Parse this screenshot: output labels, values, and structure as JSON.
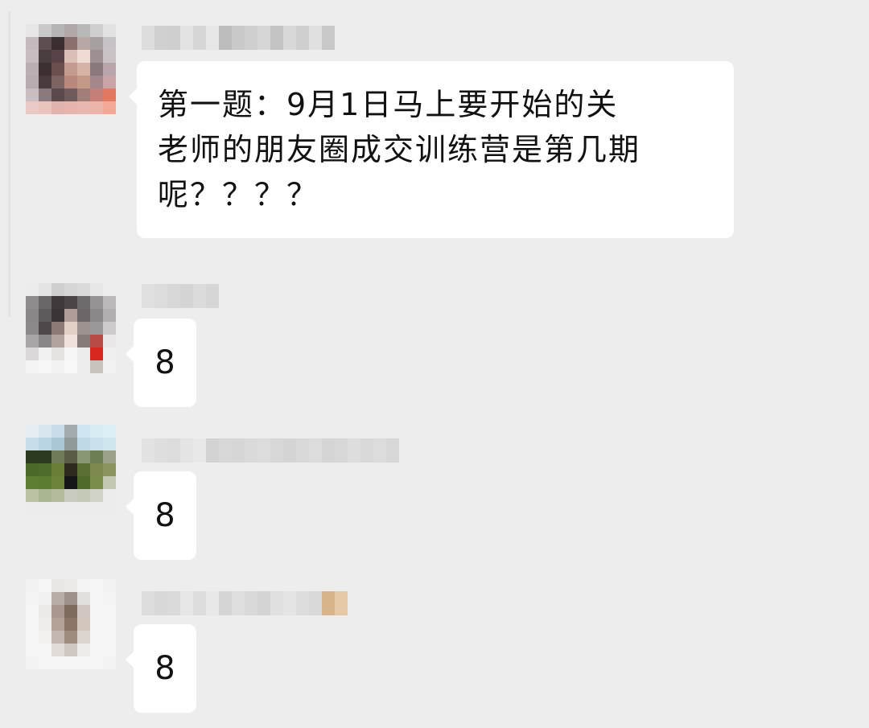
{
  "messages": [
    {
      "text_lines": [
        "第一题：9月1日马上要开始的关",
        "老师的朋友圈成交训练营是第几期",
        "呢？？？？"
      ],
      "avatar": [
        [
          "#e6e6e6",
          "#c9c9c9",
          "#b5b5b5",
          "#b0a8a8",
          "#b8b8b8",
          "#cfcfcf",
          "#e2e2e2"
        ],
        [
          "#c4b9bd",
          "#5e4e52",
          "#3a2e31",
          "#8a6f6d",
          "#b8a8a5",
          "#a7a0a0",
          "#c7c2c5"
        ],
        [
          "#c7bcc0",
          "#4a3d40",
          "#5a4347",
          "#d9bfb7",
          "#efdbd3",
          "#9e8f91",
          "#c9c3c6"
        ],
        [
          "#b9aeb2",
          "#3d3033",
          "#6a4f4e",
          "#c39b8f",
          "#d6b3a7",
          "#8a797c",
          "#b8a6ab"
        ],
        [
          "#b6acb0",
          "#4a3b3e",
          "#7b6461",
          "#b8887c",
          "#c69987",
          "#a3878b",
          "#caa3a8"
        ],
        [
          "#c8bdc1",
          "#8a7a7d",
          "#5a4a4d",
          "#6f5a5c",
          "#a27e7a",
          "#c67e78",
          "#e2785f"
        ],
        [
          "#e8c9c6",
          "#e9c3be",
          "#e1b3ad",
          "#e7b4ab",
          "#e8b8b0",
          "#eab4a9",
          "#f2a996"
        ]
      ],
      "sender": [
        "#dcdcdc",
        "#d0d0d0",
        "#cfcfcf",
        "#e3e3e3",
        "#d6d6d6",
        "#e6e6e6",
        "#bdbdbd",
        "#c9c9c9",
        "#cfcfcf",
        "#d6d6d6",
        "#c3c3c3",
        "#d8d8d8",
        "#cfcfcf",
        "#e0e0e0",
        "#c8c8c8"
      ]
    },
    {
      "text": "8",
      "avatar": [
        [
          "#ececec",
          "#e4e4e4",
          "#cfcfcf",
          "#d6d6d6",
          "#dadada",
          "#e6e6e6",
          "#ededed"
        ],
        [
          "#8f8a8c",
          "#6b6668",
          "#3f393b",
          "#4b4547",
          "#6f6a6c",
          "#979395",
          "#bdb9bb"
        ],
        [
          "#8a8587",
          "#5f5a5c",
          "#3a3436",
          "#b09d98",
          "#6c6668",
          "#8c8789",
          "#b3afb1"
        ],
        [
          "#8d8889",
          "#4e484a",
          "#8c7a74",
          "#e2cfc6",
          "#9c928f",
          "#9c9799",
          "#cfcbcd"
        ],
        [
          "#aaa5a7",
          "#8a8586",
          "#b2a39e",
          "#f0e2da",
          "#857b79",
          "#b84a47",
          "#e9e7e8"
        ],
        [
          "#dad8d9",
          "#f0f0f0",
          "#e5e2e2",
          "#f5f5f5",
          "#ececec",
          "#d8281e",
          "#efefef"
        ],
        [
          "#f4f4f4",
          "#f7f7f7",
          "#f2f2f2",
          "#f8f8f8",
          "#ededed",
          "#c8c2bd",
          "#f2f2f2"
        ]
      ],
      "sender": [
        "#e0e0e0",
        "#dcdcdc",
        "#d8d8d8",
        "#d4d4d4",
        "#dbdbdb",
        "#d6d6d6"
      ]
    },
    {
      "text": "8",
      "avatar": [
        [
          "#e5edf2",
          "#d7e6ef",
          "#c7dce8",
          "#a4abae",
          "#cfe6f0",
          "#d8ecf4",
          "#ddeff6"
        ],
        [
          "#c8ddea",
          "#b8d3e2",
          "#a9c7d6",
          "#8d9a98",
          "#bfd9e6",
          "#c8e1ec",
          "#d0e6ef"
        ],
        [
          "#2c3a20",
          "#2b3822",
          "#6e7a58",
          "#5a5c45",
          "#8a9774",
          "#6c7c53",
          "#9aa38a"
        ],
        [
          "#4b6a2a",
          "#4e6c2c",
          "#6a7e3a",
          "#2f2a1e",
          "#5b6e33",
          "#7c8a4e",
          "#8b945e"
        ],
        [
          "#5e7e34",
          "#5b7b33",
          "#6b843a",
          "#16161a",
          "#4f6a2b",
          "#7b8d4a",
          "#c3c8b4"
        ],
        [
          "#b9c3a3",
          "#a9b68f",
          "#b3bb9c",
          "#c9cbc0",
          "#c4c9b8",
          "#d1d3c6",
          "#ececec"
        ],
        [
          "#ececec",
          "#ececec",
          "#ececec",
          "#ececec",
          "#ececec",
          "#ececec",
          "#ececec"
        ]
      ],
      "sender": [
        "#e2e2e2",
        "#dedede",
        "#dcdcdc",
        "#e4e4e4",
        "#e8e8e8",
        "#d2d2d2",
        "#d8d8d8",
        "#d6d6d6",
        "#dadada",
        "#dcdcdc",
        "#d7d7d7",
        "#d4d4d4",
        "#d9d9d9",
        "#dcdcdc",
        "#d5d5d5",
        "#d8d8d8",
        "#dddddd",
        "#d9d9d9",
        "#dcdcdc",
        "#d7d7d7"
      ]
    },
    {
      "text": "8",
      "avatar": [
        [
          "#f2f2f2",
          "#f6f6f6",
          "#e9e6e4",
          "#ece9e7",
          "#f4f4f4",
          "#f6f6f6",
          "#f2f2f2"
        ],
        [
          "#f4f4f4",
          "#f2f1f1",
          "#b8aca7",
          "#9e918b",
          "#e3dfdd",
          "#f6f6f6",
          "#f4f4f4"
        ],
        [
          "#f5f5f5",
          "#ece9e7",
          "#a9988f",
          "#7f6a60",
          "#cfc6c1",
          "#f6f6f6",
          "#f5f5f5"
        ],
        [
          "#f6f6f6",
          "#efedeb",
          "#b3a297",
          "#8a7566",
          "#d2c6bd",
          "#f6f6f6",
          "#f6f6f6"
        ],
        [
          "#f6f6f6",
          "#f2f0ef",
          "#c4b7af",
          "#9e8c80",
          "#dcd4cf",
          "#f6f6f6",
          "#f6f6f6"
        ],
        [
          "#f6f6f6",
          "#f5f5f5",
          "#e2dcd8",
          "#cfc7c2",
          "#eeebe9",
          "#f6f6f6",
          "#f6f6f6"
        ],
        [
          "#f3f3f3",
          "#f5f5f5",
          "#f6f6f6",
          "#f6f6f6",
          "#f6f6f6",
          "#f5f5f5",
          "#f3f3f3"
        ]
      ],
      "sender": [
        "#dcdcdc",
        "#d8d8d8",
        "#dadada",
        "#e6e6e6",
        "#dcdcdc",
        "#e8e8e8",
        "#d5d5d5",
        "#dfdfdf",
        "#d9d9d9",
        "#d4d4d4",
        "#e0e0e0",
        "#e4e4e4",
        "#dcdcdc",
        "#d9d9d9",
        "#d8b48a",
        "#e5c9a6"
      ]
    }
  ]
}
